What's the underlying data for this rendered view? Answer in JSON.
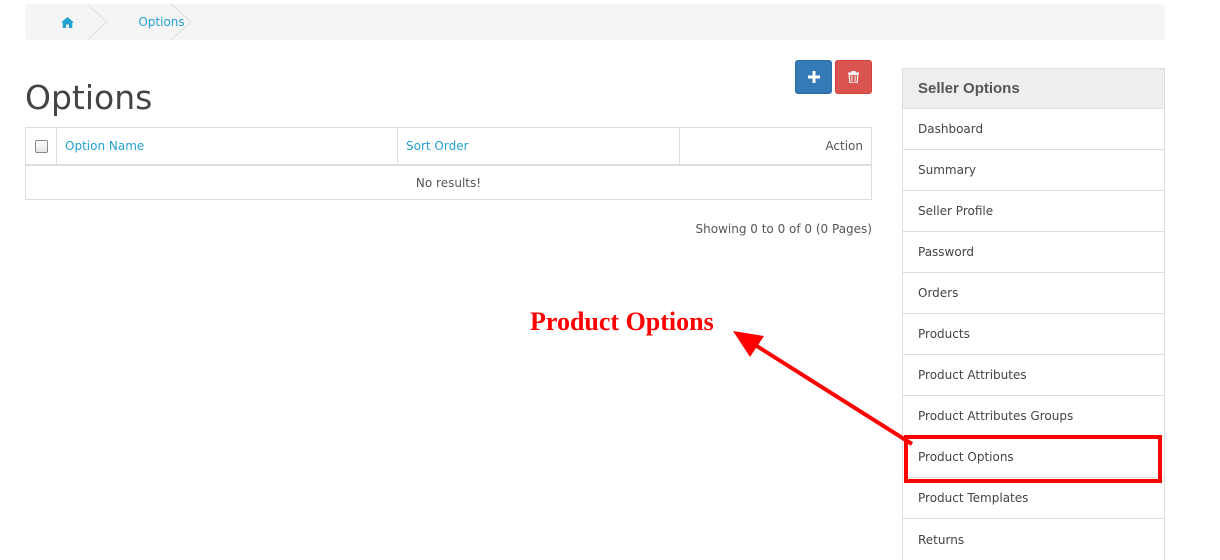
{
  "breadcrumb": {
    "home_icon": "home-icon",
    "current": "Options"
  },
  "page": {
    "title": "Options"
  },
  "toolbar": {
    "add_icon": "plus-icon",
    "delete_icon": "trash-icon"
  },
  "table": {
    "columns": [
      "Option Name",
      "Sort Order",
      "Action"
    ],
    "empty_message": "No results!",
    "pagination_text": "Showing 0 to 0 of 0 (0 Pages)"
  },
  "sidebar": {
    "heading": "Seller Options",
    "items": [
      {
        "label": "Dashboard"
      },
      {
        "label": "Summary"
      },
      {
        "label": "Seller Profile"
      },
      {
        "label": "Password"
      },
      {
        "label": "Orders"
      },
      {
        "label": "Products"
      },
      {
        "label": "Product Attributes"
      },
      {
        "label": "Product Attributes Groups"
      },
      {
        "label": "Product Options"
      },
      {
        "label": "Product Templates"
      },
      {
        "label": "Returns"
      }
    ]
  },
  "annotation": {
    "label": "Product Options",
    "color": "#ff0000"
  },
  "colors": {
    "link": "#23a1d1",
    "primary": "#337ab7",
    "danger": "#d9534f"
  }
}
